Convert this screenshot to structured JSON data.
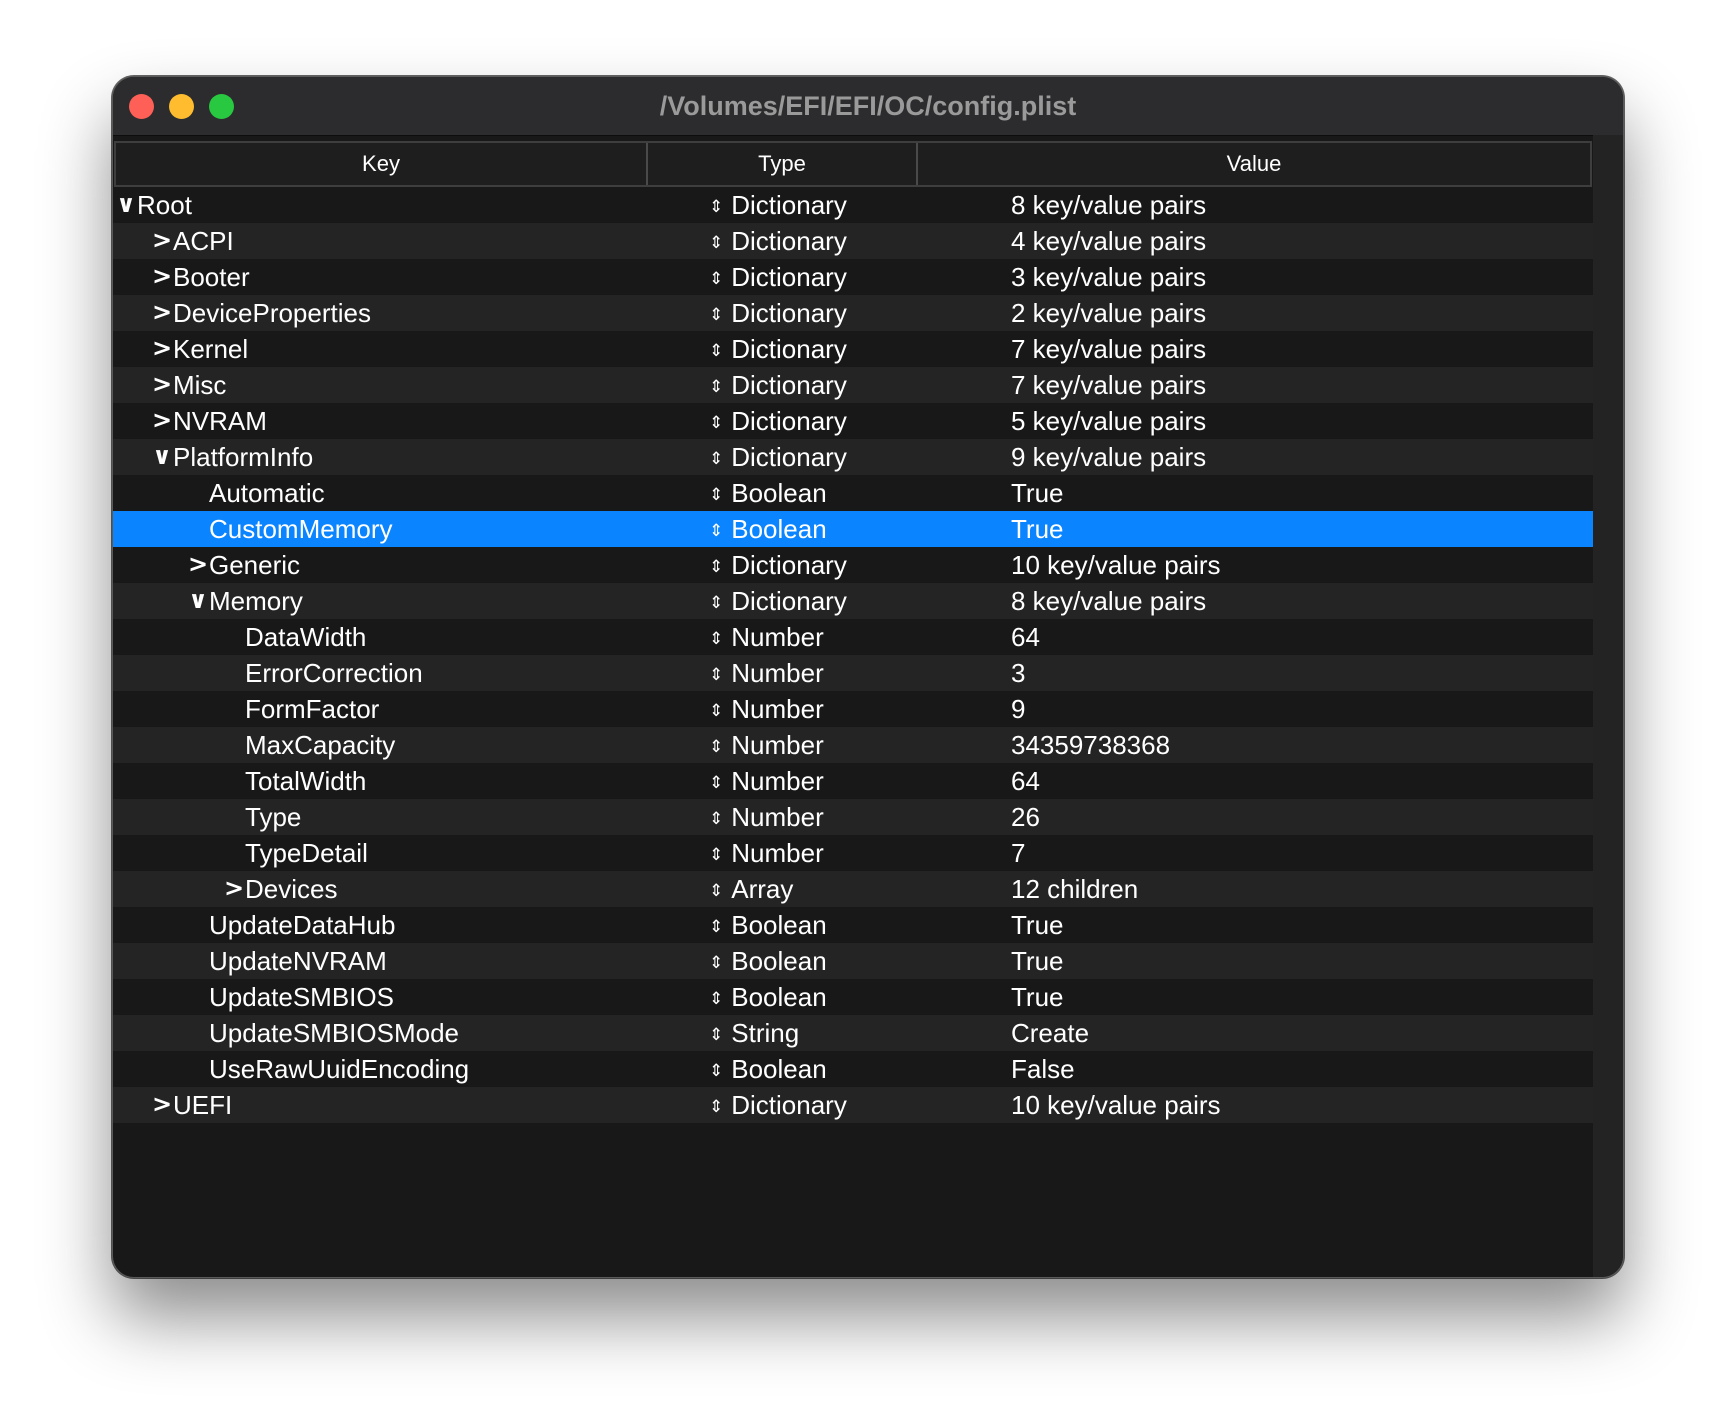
{
  "window": {
    "title": "/Volumes/EFI/EFI/OC/config.plist"
  },
  "header": {
    "key": "Key",
    "type": "Type",
    "value": "Value"
  },
  "rows": [
    {
      "key": "Root",
      "type": "Dictionary",
      "value": "8 key/value pairs",
      "depth": 0,
      "toggle": "open"
    },
    {
      "key": "ACPI",
      "type": "Dictionary",
      "value": "4 key/value pairs",
      "depth": 1,
      "toggle": "closed"
    },
    {
      "key": "Booter",
      "type": "Dictionary",
      "value": "3 key/value pairs",
      "depth": 1,
      "toggle": "closed"
    },
    {
      "key": "DeviceProperties",
      "type": "Dictionary",
      "value": "2 key/value pairs",
      "depth": 1,
      "toggle": "closed"
    },
    {
      "key": "Kernel",
      "type": "Dictionary",
      "value": "7 key/value pairs",
      "depth": 1,
      "toggle": "closed"
    },
    {
      "key": "Misc",
      "type": "Dictionary",
      "value": "7 key/value pairs",
      "depth": 1,
      "toggle": "closed"
    },
    {
      "key": "NVRAM",
      "type": "Dictionary",
      "value": "5 key/value pairs",
      "depth": 1,
      "toggle": "closed"
    },
    {
      "key": "PlatformInfo",
      "type": "Dictionary",
      "value": "9 key/value pairs",
      "depth": 1,
      "toggle": "open"
    },
    {
      "key": "Automatic",
      "type": "Boolean",
      "value": "True",
      "depth": 2,
      "toggle": "none"
    },
    {
      "key": "CustomMemory",
      "type": "Boolean",
      "value": "True",
      "depth": 2,
      "toggle": "none",
      "selected": true
    },
    {
      "key": "Generic",
      "type": "Dictionary",
      "value": "10 key/value pairs",
      "depth": 2,
      "toggle": "closed"
    },
    {
      "key": "Memory",
      "type": "Dictionary",
      "value": "8 key/value pairs",
      "depth": 2,
      "toggle": "open"
    },
    {
      "key": "DataWidth",
      "type": "Number",
      "value": "64",
      "depth": 3,
      "toggle": "none"
    },
    {
      "key": "ErrorCorrection",
      "type": "Number",
      "value": "3",
      "depth": 3,
      "toggle": "none"
    },
    {
      "key": "FormFactor",
      "type": "Number",
      "value": "9",
      "depth": 3,
      "toggle": "none"
    },
    {
      "key": "MaxCapacity",
      "type": "Number",
      "value": "34359738368",
      "depth": 3,
      "toggle": "none"
    },
    {
      "key": "TotalWidth",
      "type": "Number",
      "value": "64",
      "depth": 3,
      "toggle": "none"
    },
    {
      "key": "Type",
      "type": "Number",
      "value": "26",
      "depth": 3,
      "toggle": "none"
    },
    {
      "key": "TypeDetail",
      "type": "Number",
      "value": "7",
      "depth": 3,
      "toggle": "none"
    },
    {
      "key": "Devices",
      "type": "Array",
      "value": "12 children",
      "depth": 3,
      "toggle": "closed"
    },
    {
      "key": "UpdateDataHub",
      "type": "Boolean",
      "value": "True",
      "depth": 2,
      "toggle": "none"
    },
    {
      "key": "UpdateNVRAM",
      "type": "Boolean",
      "value": "True",
      "depth": 2,
      "toggle": "none"
    },
    {
      "key": "UpdateSMBIOS",
      "type": "Boolean",
      "value": "True",
      "depth": 2,
      "toggle": "none"
    },
    {
      "key": "UpdateSMBIOSMode",
      "type": "String",
      "value": "Create",
      "depth": 2,
      "toggle": "none"
    },
    {
      "key": "UseRawUuidEncoding",
      "type": "Boolean",
      "value": "False",
      "depth": 2,
      "toggle": "none"
    },
    {
      "key": "UEFI",
      "type": "Dictionary",
      "value": "10 key/value pairs",
      "depth": 1,
      "toggle": "closed"
    }
  ],
  "glyphs": {
    "open": "∨",
    "closed": ">",
    "stepper": "⇕"
  },
  "colors": {
    "selection": "#0a84ff",
    "close": "#fe5f57",
    "minimize": "#febc2e",
    "zoom": "#28c840"
  }
}
